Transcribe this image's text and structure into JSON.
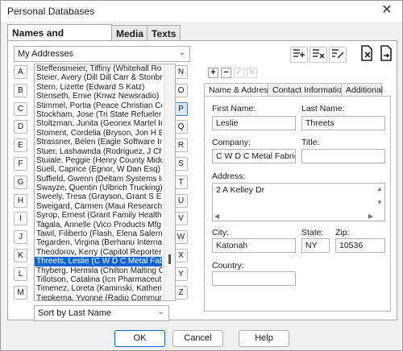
{
  "window": {
    "title": "Personal Databases",
    "close_glyph": "✕"
  },
  "tabs": [
    {
      "label": "Names and Addresses",
      "active": true
    },
    {
      "label": "Media",
      "active": false
    },
    {
      "label": "Texts",
      "active": false
    }
  ],
  "database_select": {
    "value": "My Addresses"
  },
  "sort_select": {
    "value": "Sort by Last Name"
  },
  "letters_left": [
    "A",
    "B",
    "C",
    "D",
    "E",
    "F",
    "G",
    "H",
    "I",
    "J",
    "K",
    "L",
    "M"
  ],
  "letters_right": [
    "N",
    "O",
    "P",
    "Q",
    "R",
    "S",
    "T",
    "U",
    "V",
    "W",
    "X",
    "Y",
    "Z"
  ],
  "active_letter": "P",
  "names_list": [
    {
      "text": "Steffensmeier, Tiffiny (Whitehall Rob",
      "selected": false
    },
    {
      "text": "Steier, Avery (Dill Dill Carr & Stonbrak",
      "selected": false
    },
    {
      "text": "Stern, Lizette (Edward S Katz)",
      "selected": false
    },
    {
      "text": "Stenseth, Ernie (Knwz Newsradio)",
      "selected": false
    },
    {
      "text": "Stimmel, Portia (Peace Christian Cen",
      "selected": false
    },
    {
      "text": "Stockham, Jose (Tri State Refueler (",
      "selected": false
    },
    {
      "text": "Stoltzman, Junita (Geonex Martel Inc",
      "selected": false
    },
    {
      "text": "Stoment, Cordelia (Bryson, Jon H E",
      "selected": false
    },
    {
      "text": "Strassner, Belen (Eagle Software Inc",
      "selected": false
    },
    {
      "text": "Stuer, Lashawnda (Rodriguez, J Chri",
      "selected": false
    },
    {
      "text": "Stuiale, Peggie (Henry County Middl",
      "selected": false
    },
    {
      "text": "Suell, Caprice (Egnor, W Dan Esq)",
      "selected": false
    },
    {
      "text": "Suffield, Gwenn (Deltam Systems Inc",
      "selected": false
    },
    {
      "text": "Swayze, Quentin (Ulbrich Trucking)",
      "selected": false
    },
    {
      "text": "Sweely, Tresa (Grayson, Grant S Esc",
      "selected": false
    },
    {
      "text": "Sweigard, Carmen (Maui Research &",
      "selected": false
    },
    {
      "text": "Syrop, Ernest (Grant Family Health C",
      "selected": false
    },
    {
      "text": "Tagala, Annelle (Vico Products Mfg (",
      "selected": false
    },
    {
      "text": "Tawil, Filiberto (Flash, Elena Salerno",
      "selected": false
    },
    {
      "text": "Tegarden, Virgina (Berhanu Internati",
      "selected": false
    },
    {
      "text": "Theodorov, Kerry (Capitol Reporters)",
      "selected": false
    },
    {
      "text": "Threets, Leslie (C W D C Metal Fabri",
      "selected": true
    },
    {
      "text": "Thyberg, Hermila (Chilton Malting Co",
      "selected": false
    },
    {
      "text": "Tillotson, Catalina (Icn Pharmaceutic",
      "selected": false
    },
    {
      "text": "Timenez, Loreta (Kaminski, Katherine",
      "selected": false
    },
    {
      "text": "Tjepkema, Yvonne (Radio Communi",
      "selected": false
    }
  ],
  "toolbar_icons": [
    "add-record-icon",
    "delete-record-icon",
    "edit-record-icon",
    "export-icon",
    "import-icon"
  ],
  "record_buttons": {
    "add": "+",
    "remove": "−",
    "check": "✓",
    "cross": "✕"
  },
  "subtabs": [
    {
      "label": "Name & Address",
      "active": true
    },
    {
      "label": "Contact Information",
      "active": false
    },
    {
      "label": "Additional",
      "active": false
    }
  ],
  "form": {
    "first_name_label": "First Name:",
    "first_name": "Leslie",
    "last_name_label": "Last Name:",
    "last_name": "Threets",
    "company_label": "Company:",
    "company": "C W D C Metal Fabricato",
    "title_label": "Title:",
    "title": "",
    "address_label": "Address:",
    "address": "2 A Kelley Dr",
    "city_label": "City:",
    "city": "Katonah",
    "state_label": "State:",
    "state": "NY",
    "zip_label": "Zip:",
    "zip": "10536",
    "country_label": "Country:",
    "country": ""
  },
  "buttons": {
    "ok": "OK",
    "cancel": "Cancel",
    "help": "Help"
  }
}
